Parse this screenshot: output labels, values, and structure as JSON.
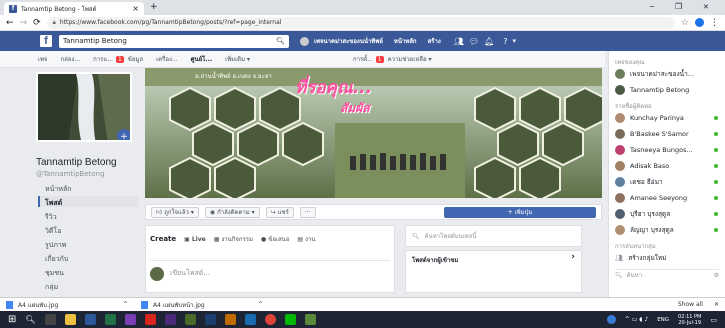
{
  "browser": {
    "tab_title": "Tannamtip Betong - โพสต์",
    "tab_close": "×",
    "new_tab": "+",
    "window_controls": [
      "─",
      "❐",
      "✕"
    ],
    "url": "https://www.facebook.com/pg/TannamtipBetong/posts/?ref=page_internal"
  },
  "fb_header": {
    "logo": "f",
    "search_value": "Tannamtip Betong",
    "page_link": "เพจนาคม่าสะของนนํ่าทิพย์",
    "home": "หน้าหลัก",
    "create": "สร้าง"
  },
  "page_nav": {
    "items": [
      "เพจ",
      "กล่อง...",
      "การแ...",
      "ข้อมูล",
      "เครื่อง...",
      "ศูนย์โ...",
      "เพิ่มเติม ▾"
    ],
    "settings": "การตั้...",
    "help": "ความช่วยเหลือ ▾",
    "notif_badge": "1"
  },
  "profile": {
    "name": "Tannamtip Betong",
    "handle": "@TannamtipBetong",
    "nav": [
      "หน้าหลัก",
      "โพสต์",
      "รีวิว",
      "วิดีโอ",
      "รูปภาพ",
      "เกี่ยวกับ",
      "ชุมชน",
      "กลุ่ม"
    ]
  },
  "cover": {
    "banner_text": "ที่รอคุณ...",
    "banner_text2": "สัมผัส",
    "badge": "ล.ถ่านน้ำทิพย์ อ.เบตง จ.ยะลา"
  },
  "actions": {
    "liked": "ถูกใจแล้ว ▾",
    "following": "กำลังติดตาม ▾",
    "share": "แชร์",
    "more": "···",
    "like_page": "+ เพิ่มปุ่ม"
  },
  "create_post": {
    "label": "Create",
    "live": "Live",
    "event": "งานกิจกรรม",
    "offer": "ข้อเสนอ",
    "job": "งาน",
    "placeholder": "เขียนโพสต์..."
  },
  "search_posts": {
    "placeholder": "ค้นหาโพสต์บนเพจนี้"
  },
  "visit_box": {
    "title": "โพสต์จากผู้เข้าชม",
    "chevron": "›"
  },
  "chat": {
    "section1": "เพจของคุณ",
    "pages": [
      {
        "name": "เพจนาคม่าสะของน้ำ...",
        "online": false
      },
      {
        "name": "Tannamtip Betong",
        "online": false
      }
    ],
    "section2": "รายชื่อผู้ติดต่อ",
    "contacts": [
      {
        "name": "Kunchay Parinya",
        "online": true
      },
      {
        "name": "B'Baskee S'Samor",
        "online": true
      },
      {
        "name": "Tasneeya Bungos...",
        "online": true
      },
      {
        "name": "Adisak Baso",
        "online": true
      },
      {
        "name": "เดชอ ธีอ่มา",
        "online": true
      },
      {
        "name": "Amanee Seeyong",
        "online": true
      },
      {
        "name": "บุรีฮา บุรงสุดูล",
        "online": true
      },
      {
        "name": "ลัญญา บุรงสุดูล",
        "online": true
      }
    ],
    "section3": "การสนทนากลุ่ม",
    "create_group": "สร้างกลุ่มใหม่",
    "search_placeholder": "ค้นหา"
  },
  "downloads": {
    "items": [
      "A4 แผ่นพับ.jpg",
      "A4 แผ่นพับหน้า.jpg"
    ],
    "show_all": "Show all",
    "close": "✕"
  },
  "taskbar": {
    "time": "02:11 PM",
    "date": "20-Jul-19",
    "lang": "ENG"
  },
  "colors": {
    "fb_blue": "#3b5998",
    "button_blue": "#4267b2",
    "online_green": "#42b72a"
  }
}
